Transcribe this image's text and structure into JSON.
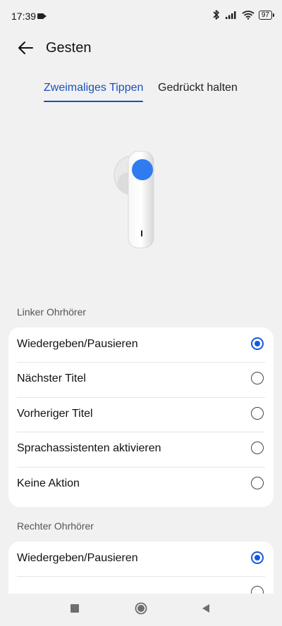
{
  "status": {
    "time": "17:39",
    "battery": "97"
  },
  "header": {
    "title": "Gesten"
  },
  "tabs": [
    {
      "label": "Zweimaliges Tippen",
      "active": true
    },
    {
      "label": "Gedrückt halten",
      "active": false
    }
  ],
  "left_earbud": {
    "section_label": "Linker Ohrhörer",
    "options": [
      {
        "label": "Wiedergeben/Pausieren",
        "checked": true
      },
      {
        "label": "Nächster Titel",
        "checked": false
      },
      {
        "label": "Vorheriger Titel",
        "checked": false
      },
      {
        "label": "Sprachassistenten aktivieren",
        "checked": false
      },
      {
        "label": "Keine Aktion",
        "checked": false
      }
    ]
  },
  "right_earbud": {
    "section_label": "Rechter Ohrhörer",
    "options": [
      {
        "label": "Wiedergeben/Pausieren",
        "checked": true
      }
    ]
  },
  "colors": {
    "accent": "#1559e0",
    "tab_active": "#1a4fbe",
    "background": "#f1f1f1"
  },
  "icons": {
    "back": "arrow-left-icon",
    "recent": "square-icon",
    "home": "circle-icon",
    "back_nav": "triangle-left-icon"
  }
}
